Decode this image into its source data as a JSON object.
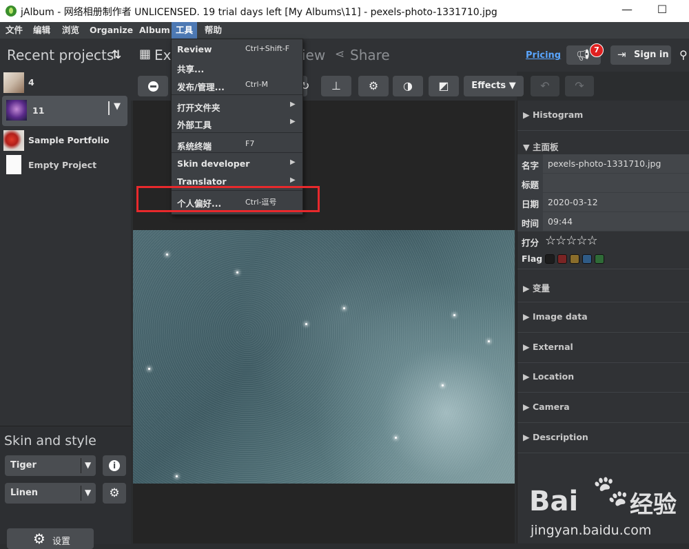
{
  "window": {
    "title": "jAlbum - 网络相册制作者 UNLICENSED. 19 trial days left [My Albums\\11] - pexels-photo-1331710.jpg",
    "minimize": "—",
    "maximize": "☐"
  },
  "menubar": [
    "文件",
    "编辑",
    "浏览",
    "Organize",
    "Album",
    "工具",
    "帮助"
  ],
  "left": {
    "recent_title": "Recent projects",
    "sort_icon": "⇅",
    "projects": [
      "4",
      "11",
      "Sample Portfolio",
      "Empty Project"
    ],
    "skin_title": "Skin and style",
    "skin": "Tiger",
    "style": "Linen",
    "settings_label": "设置",
    "info_icon": "i",
    "gear_icon": "⚙"
  },
  "topbar": {
    "tab_explore": "Ex",
    "tab_view": "iew",
    "tab_share": "Share",
    "pricing": "Pricing",
    "notif_count": "7",
    "sign_in": "Sign in"
  },
  "toolbar": {
    "effects": "Effects ▼"
  },
  "tools_menu": {
    "items": [
      {
        "label": "Review",
        "shortcut": "Ctrl+Shift-F"
      },
      {
        "label": "共享...",
        "shortcut": ""
      },
      {
        "label": "发布/管理...",
        "shortcut": "Ctrl-M"
      },
      {
        "label": "打开文件夹",
        "shortcut": ""
      },
      {
        "label": "外部工具",
        "shortcut": ""
      },
      {
        "label": "系统终端",
        "shortcut": "F7"
      },
      {
        "label": "Skin developer",
        "shortcut": ""
      },
      {
        "label": "Translator",
        "shortcut": ""
      },
      {
        "label": "个人偏好...",
        "shortcut": "Ctrl-逗号"
      }
    ]
  },
  "right": {
    "histogram": "▶ Histogram",
    "main_panel": "▼ 主面板",
    "fields": {
      "name_key": "名字",
      "name_val": "pexels-photo-1331710.jpg",
      "title_key": "标题",
      "title_val": "",
      "date_key": "日期",
      "date_val": "2020-03-12",
      "time_key": "时间",
      "time_val": "09:44",
      "rating_key": "打分",
      "rating_stars": "☆☆☆☆☆",
      "flag_key": "Flag"
    },
    "flag_colors": [
      "#1c1c1c",
      "#7a2424",
      "#8a6d2b",
      "#2f5b86",
      "#2f6b37"
    ],
    "sections": [
      "▶ 变量",
      "▶ Image data",
      "▶ External",
      "▶ Location",
      "▶ Camera",
      "▶ Description"
    ]
  },
  "watermark": {
    "bai": "Bai",
    "du": "经验",
    "url": "jingyan.baidu.com"
  }
}
